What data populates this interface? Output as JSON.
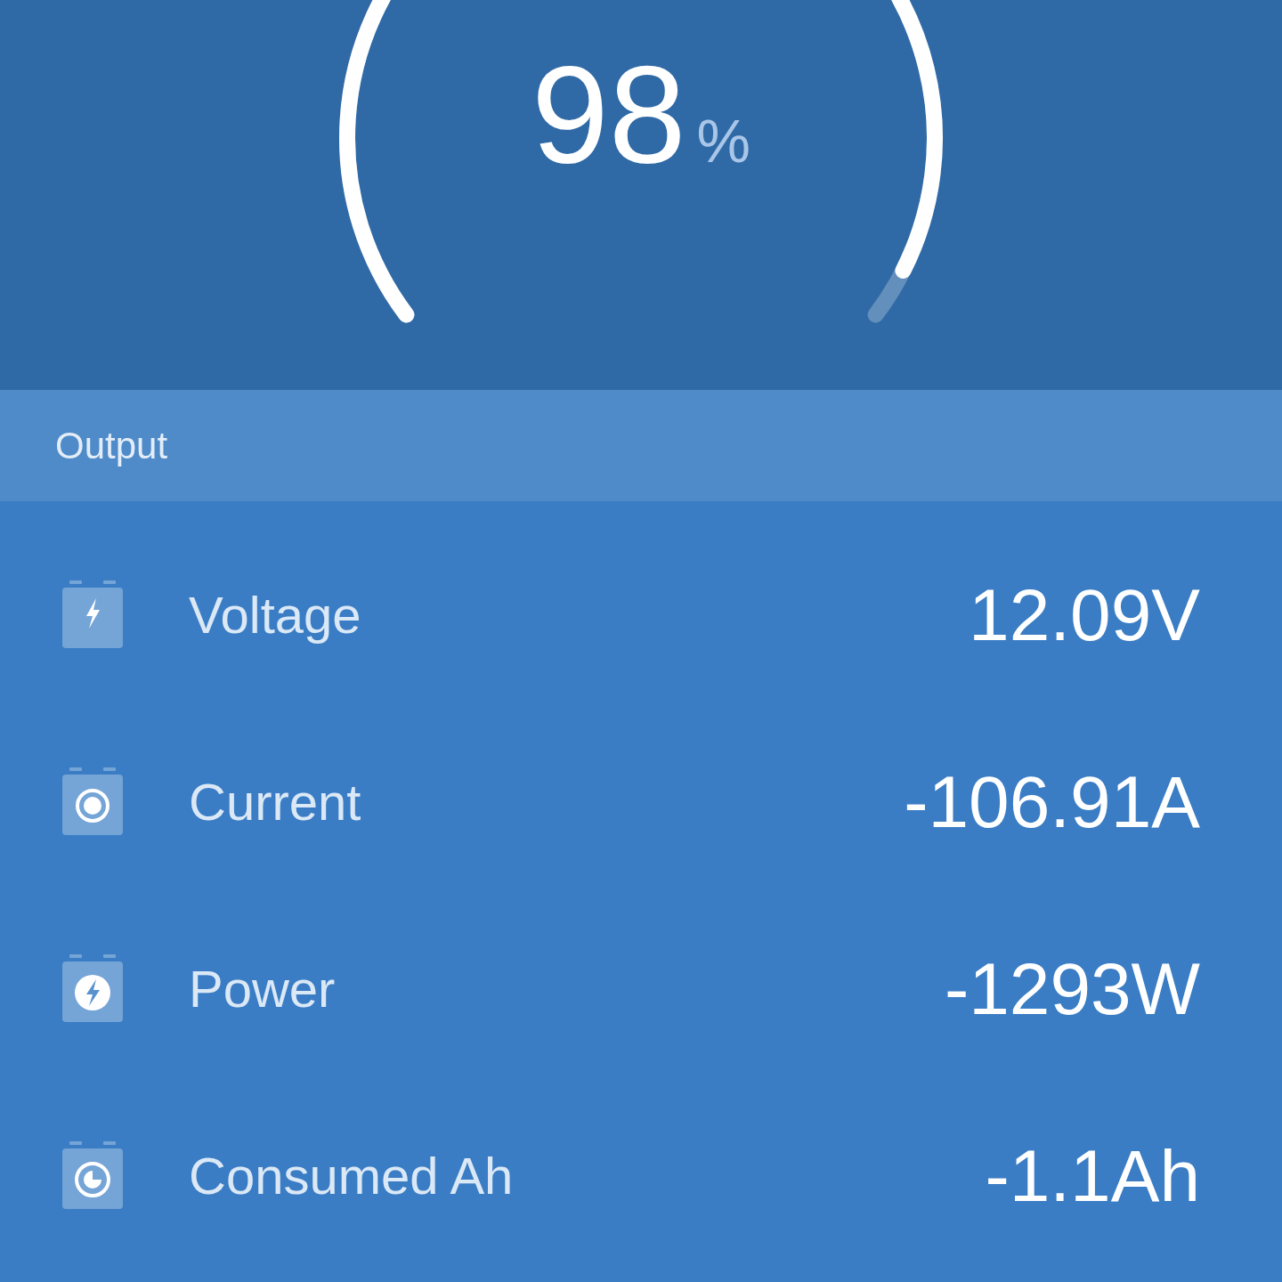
{
  "gauge": {
    "value": "98",
    "unit": "%"
  },
  "section": {
    "title": "Output"
  },
  "rows": [
    {
      "kind": "bolt",
      "label": "Voltage",
      "value": "12.09V"
    },
    {
      "kind": "ring",
      "label": "Current",
      "value": "-106.91A"
    },
    {
      "kind": "bolt-circle",
      "label": "Power",
      "value": "-1293W"
    },
    {
      "kind": "pie",
      "label": "Consumed Ah",
      "value": "-1.1Ah"
    }
  ]
}
